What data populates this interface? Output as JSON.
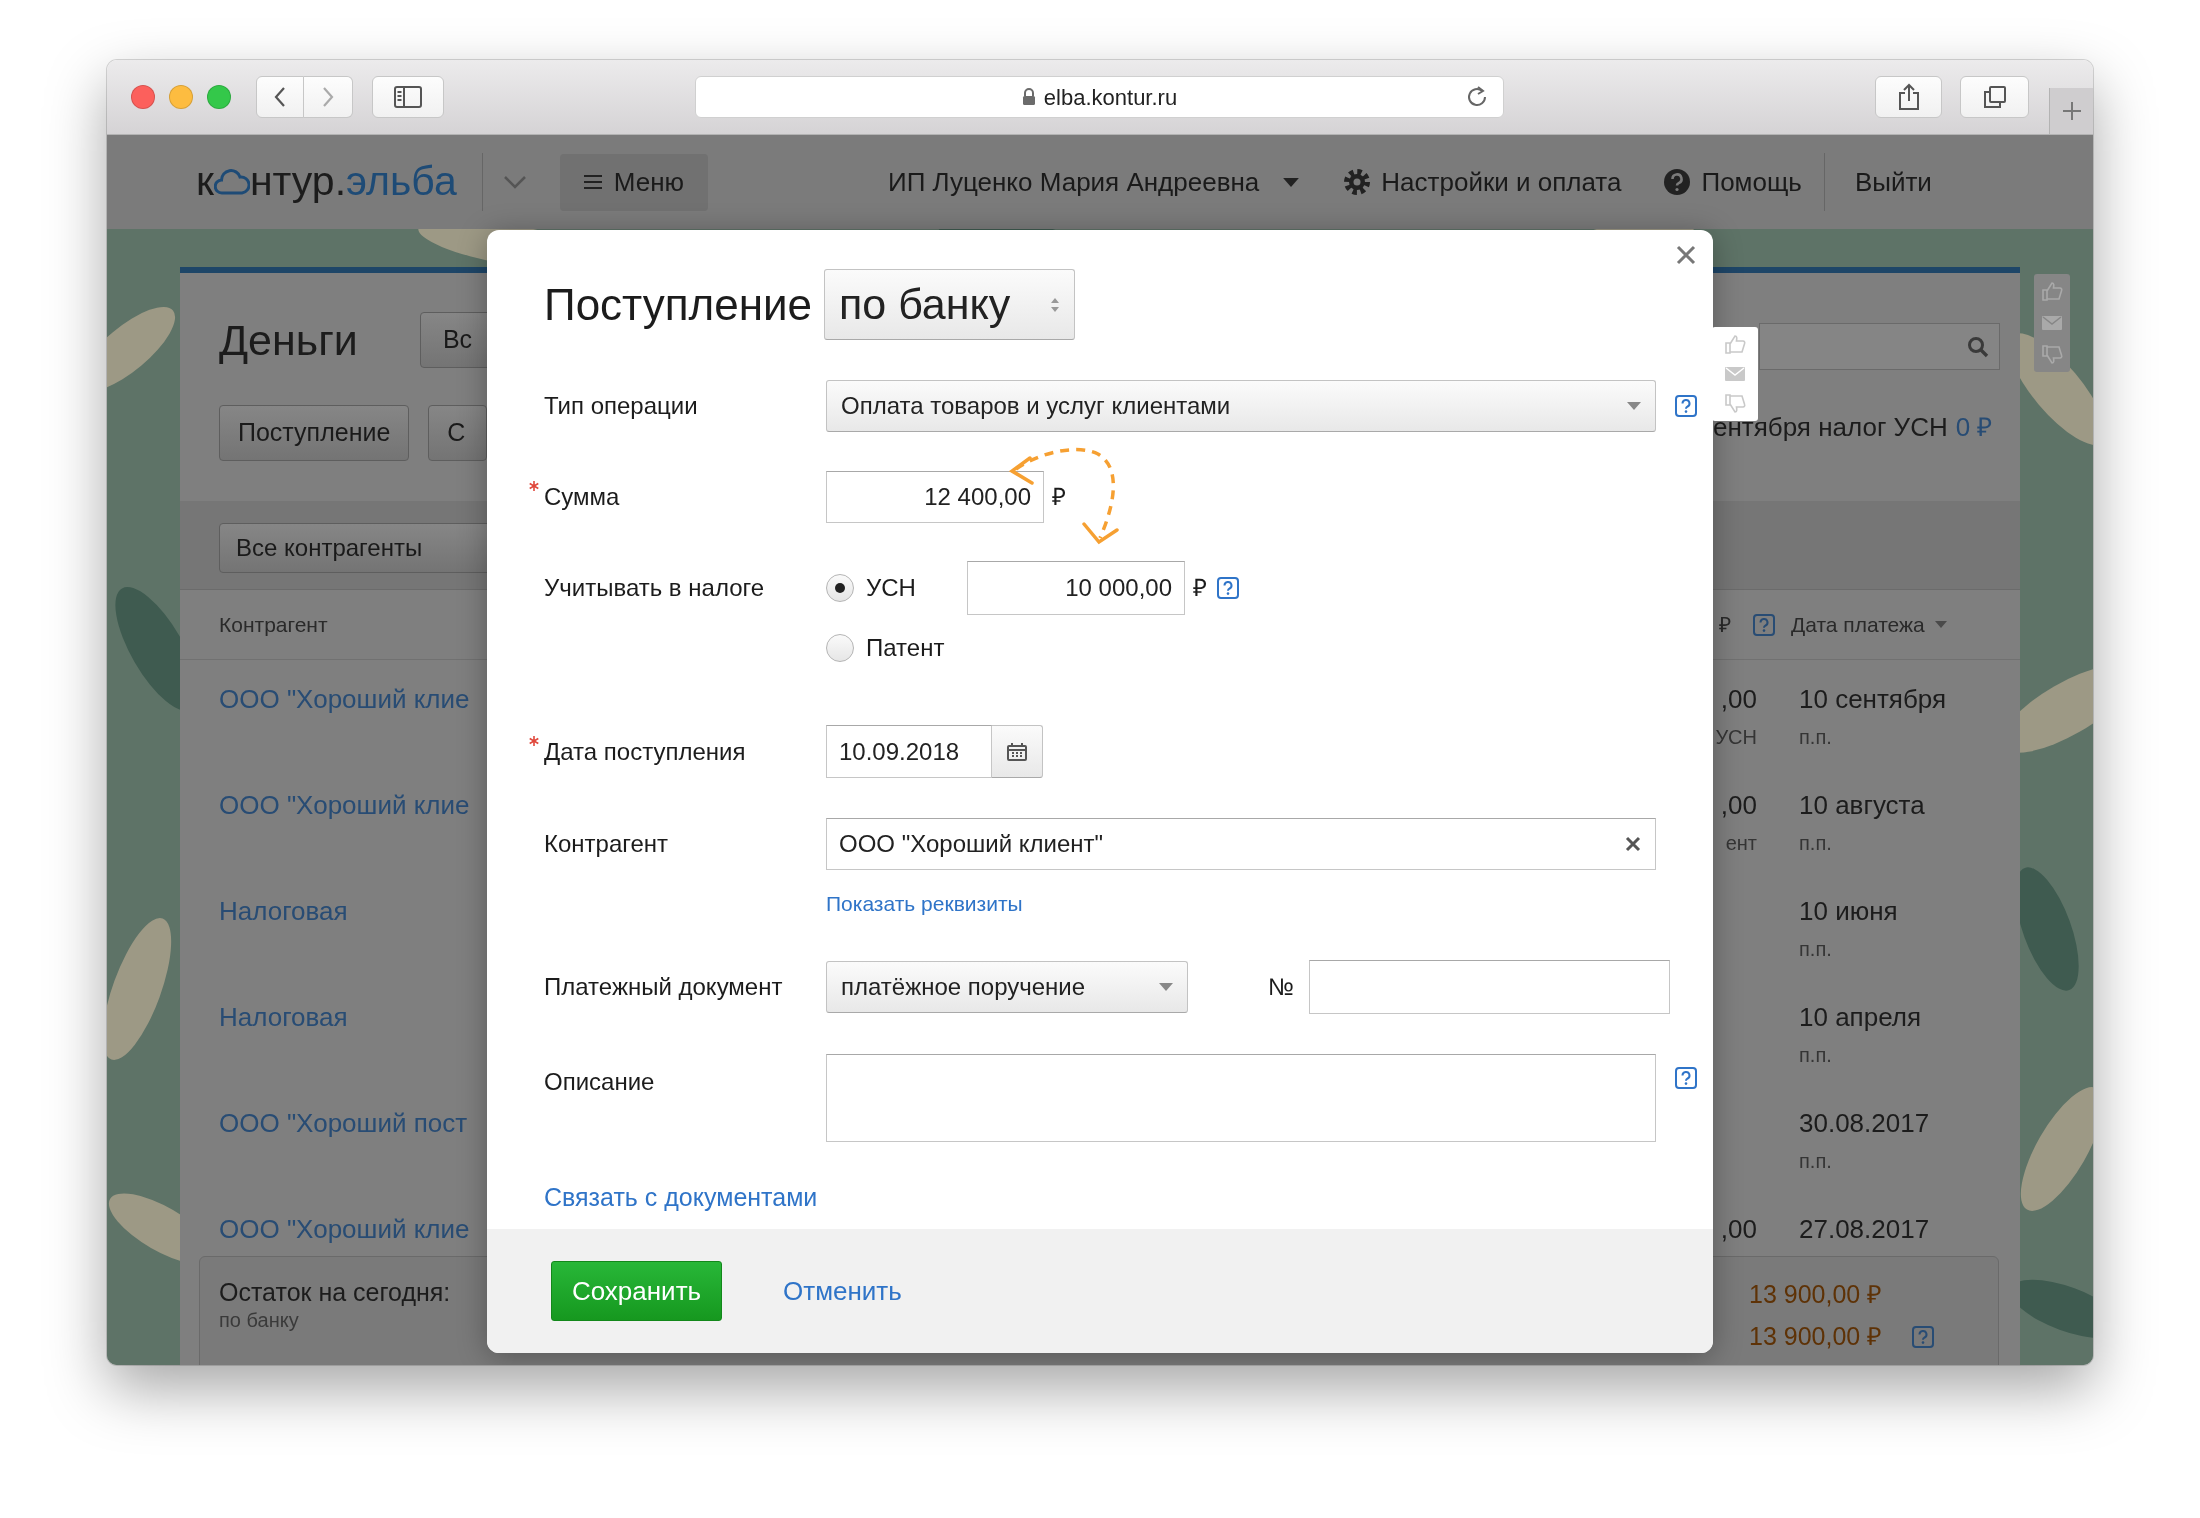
{
  "browser": {
    "url": "elba.kontur.ru"
  },
  "header": {
    "logo": {
      "prefix": "к",
      "suffix": "нтур.",
      "brand": "эльба"
    },
    "menu": "Меню",
    "user": "ИП Луценко Мария Андреевна",
    "settings": "Настройки и оплата",
    "help": "Помощь",
    "logout": "Выйти"
  },
  "page": {
    "title": "Деньги",
    "title_button": "Вс",
    "buttons": [
      "Поступление",
      "С"
    ],
    "tax_notice": "ентября налог УСН",
    "tax_amount": "0 ₽",
    "filter": "Все контрагенты",
    "columns": {
      "counterparty": "Контрагент",
      "amount": "₽",
      "date": "Дата платежа"
    },
    "rows": [
      {
        "counterparty": "ООО \"Хороший клие",
        "amount": ",00",
        "amount_note": "УСН",
        "date": "10 сентября",
        "doc": "п.п."
      },
      {
        "counterparty": "ООО \"Хороший клие",
        "amount": ",00",
        "amount_note": "ент",
        "date": "10 августа",
        "doc": "п.п."
      },
      {
        "counterparty": "Налоговая",
        "date": "10 июня",
        "doc": "п.п."
      },
      {
        "counterparty": "Налоговая",
        "date": "10 апреля",
        "doc": "п.п."
      },
      {
        "counterparty": "ООО \"Хороший пост",
        "date": "30.08.2017",
        "doc": "п.п."
      },
      {
        "counterparty": "ООО \"Хороший клие",
        "amount": ",00",
        "date": "27.08.2017"
      }
    ],
    "summary": {
      "label": "Остаток на сегодня:",
      "note": "по банку",
      "values": [
        "13 900,00 ₽",
        "13 900,00 ₽"
      ]
    }
  },
  "dialog": {
    "title": "Поступление",
    "source": "по банку",
    "operation": {
      "label": "Тип операции",
      "required": false,
      "value": "Оплата товаров и услуг клиентами"
    },
    "amount": {
      "label": "Сумма",
      "required": true,
      "value": "12 400,00",
      "currency": "₽"
    },
    "tax": {
      "label": "Учитывать в налоге",
      "required": false,
      "options": [
        {
          "label": "УСН",
          "selected": true,
          "value": "10 000,00",
          "currency": "₽"
        },
        {
          "label": "Патент",
          "selected": false
        }
      ]
    },
    "date": {
      "label": "Дата поступления",
      "required": true,
      "value": "10.09.2018"
    },
    "counterparty": {
      "label": "Контрагент",
      "required": false,
      "value": "ООО \"Хороший клиент\"",
      "details_link": "Показать реквизиты"
    },
    "document": {
      "label": "Платежный документ",
      "required": false,
      "value": "платёжное поручение",
      "number_label": "№"
    },
    "description": {
      "label": "Описание",
      "required": false
    },
    "link": "Связать с документами",
    "save": "Сохранить",
    "cancel": "Отменить"
  }
}
